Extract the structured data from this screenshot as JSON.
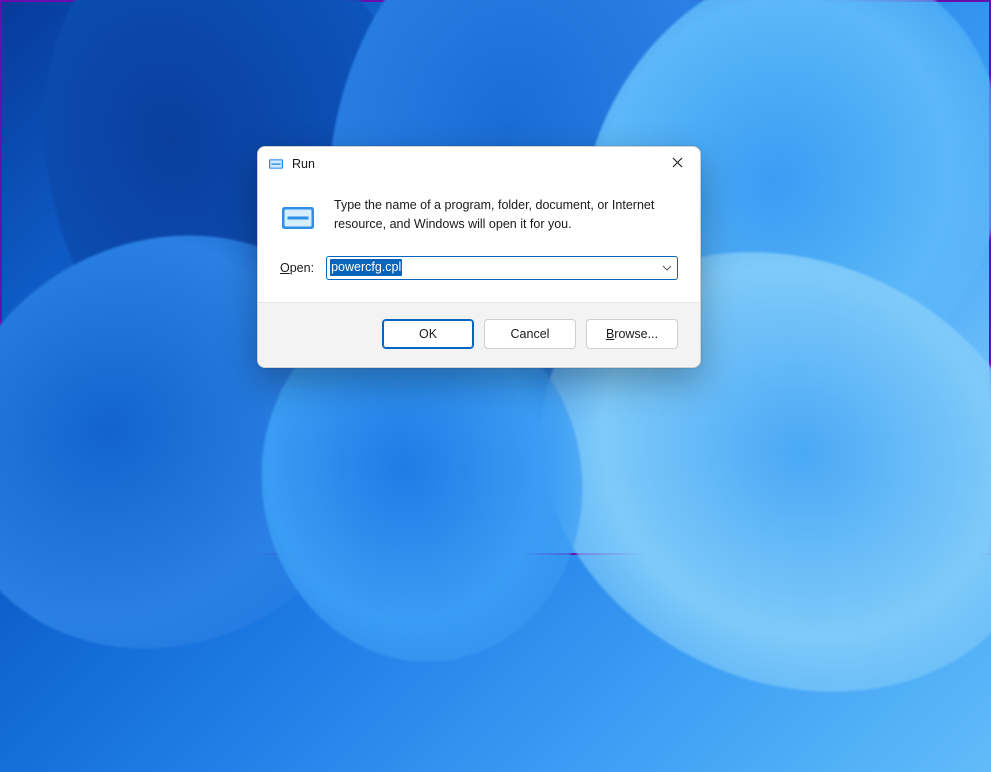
{
  "dialog": {
    "title": "Run",
    "description": "Type the name of a program, folder, document, or Internet resource, and Windows will open it for you.",
    "open_label_prefix": "O",
    "open_label_rest": "pen:",
    "input_value": "powercfg.cpl",
    "buttons": {
      "ok": "OK",
      "cancel": "Cancel",
      "browse_prefix": "B",
      "browse_rest": "rowse..."
    }
  },
  "icons": {
    "titlebar": "run-icon",
    "close": "close-icon",
    "body": "run-large-icon",
    "chevron": "chevron-down-icon"
  },
  "colors": {
    "accent": "#0067c0",
    "selection": "#0a64bc"
  }
}
